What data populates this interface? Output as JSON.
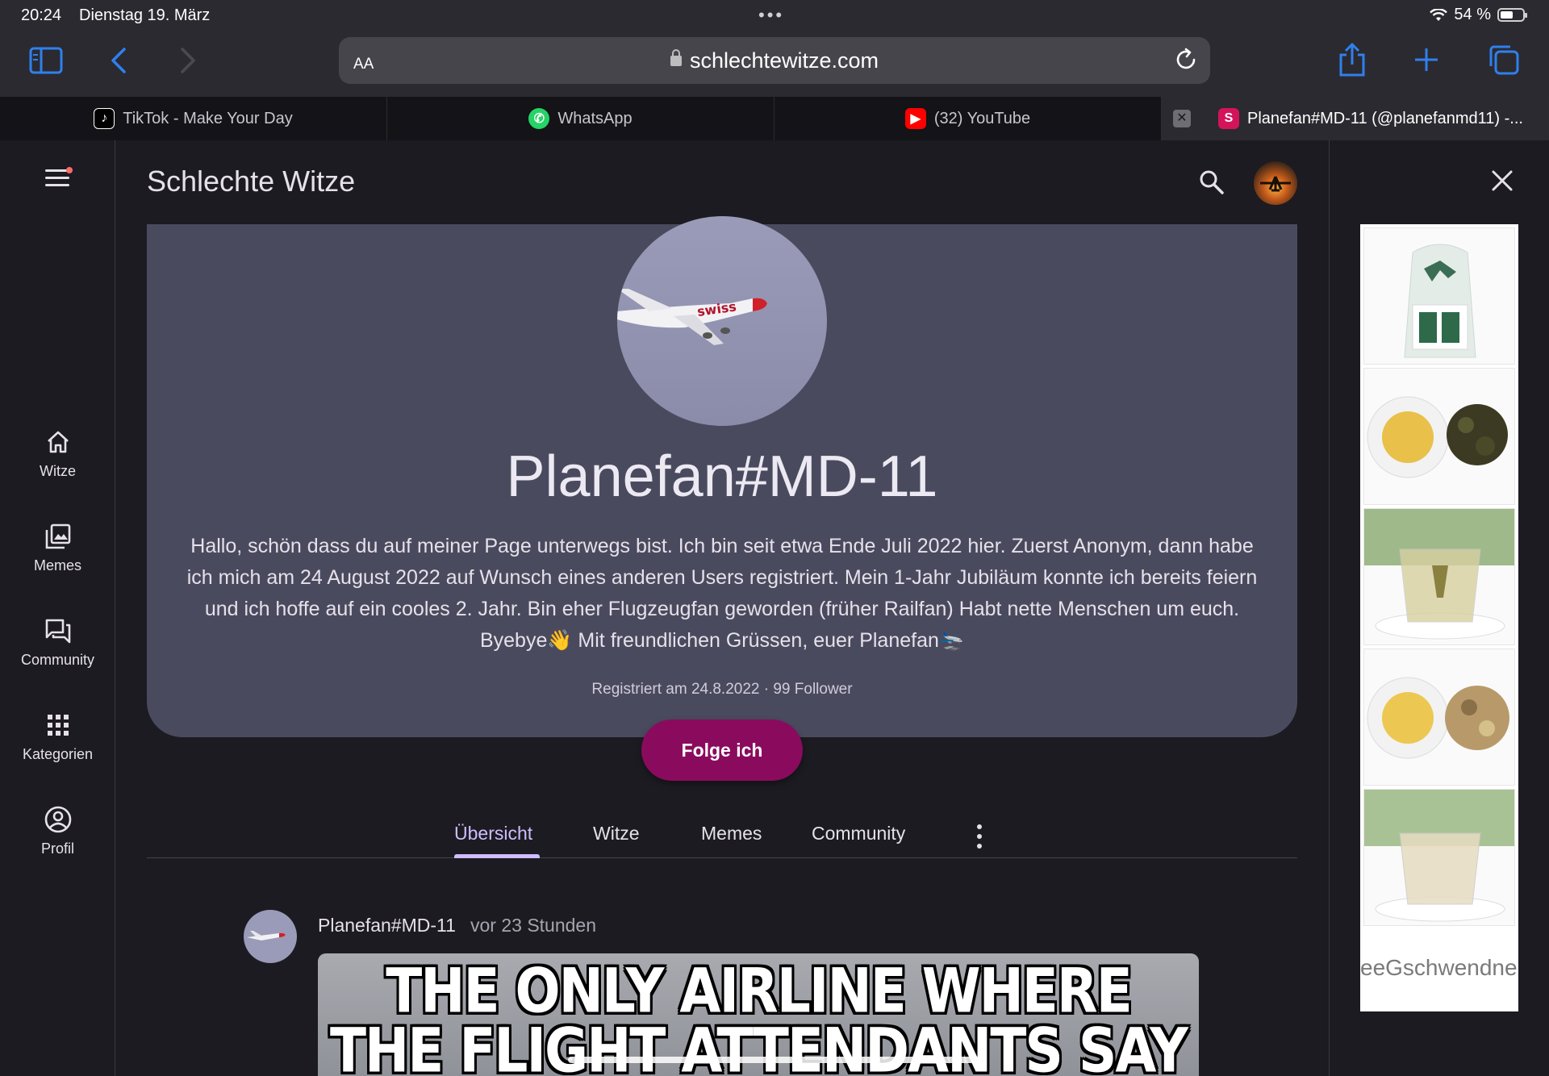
{
  "statusbar": {
    "time": "20:24",
    "date": "Dienstag 19. März",
    "battery": "54 %"
  },
  "browser": {
    "url_prefix": "AA",
    "url": "schlechtewitze.com"
  },
  "tabs": [
    {
      "title": "TikTok - Make Your Day",
      "favicon": "tiktok"
    },
    {
      "title": "WhatsApp",
      "favicon": "whatsapp"
    },
    {
      "title": "(32) YouTube",
      "favicon": "youtube"
    },
    {
      "title": "Planefan#MD-11 (@planefanmd11) -...",
      "favicon": "S",
      "active": true
    }
  ],
  "site": {
    "title": "Schlechte Witze",
    "nav": [
      {
        "label": "Witze",
        "icon": "home-icon"
      },
      {
        "label": "Memes",
        "icon": "image-stack-icon"
      },
      {
        "label": "Community",
        "icon": "forum-icon"
      },
      {
        "label": "Kategorien",
        "icon": "grid-icon"
      },
      {
        "label": "Profil",
        "icon": "account-circle-icon"
      }
    ]
  },
  "profile": {
    "username": "Planefan#MD-11",
    "bio": "Hallo, schön dass du auf meiner Page unterwegs bist. Ich bin seit etwa Ende Juli 2022 hier. Zuerst Anonym, dann habe ich mich am 24 August 2022 auf Wunsch eines anderen Users registriert. Mein 1-Jahr Jubiläum konnte ich bereits feiern und ich hoffe auf ein cooles 2. Jahr. Bin eher Flugzeugfan geworden (früher Railfan) Habt nette Menschen um euch. Byebye👋 Mit freundlichen Grüssen, euer Planefan🛬",
    "meta": "Registriert am 24.8.2022 · 99 Follower",
    "follow_label": "Folge ich",
    "airline_text": "swiss"
  },
  "profile_tabs": [
    "Übersicht",
    "Witze",
    "Memes",
    "Community"
  ],
  "post": {
    "author": "Planefan#MD-11",
    "time": "vor 23 Stunden",
    "meme_line1": "THE ONLY AIRLINE WHERE",
    "meme_line2": "THE FLIGHT ATTENDANTS SAY"
  },
  "ad": {
    "brand": "eeGschwendne"
  },
  "colors": {
    "accent": "#d0bcff",
    "follow_button": "#8a0b5e",
    "card": "#4a4a5f",
    "background": "#1c1b21",
    "safari_blue": "#2f80ed"
  }
}
